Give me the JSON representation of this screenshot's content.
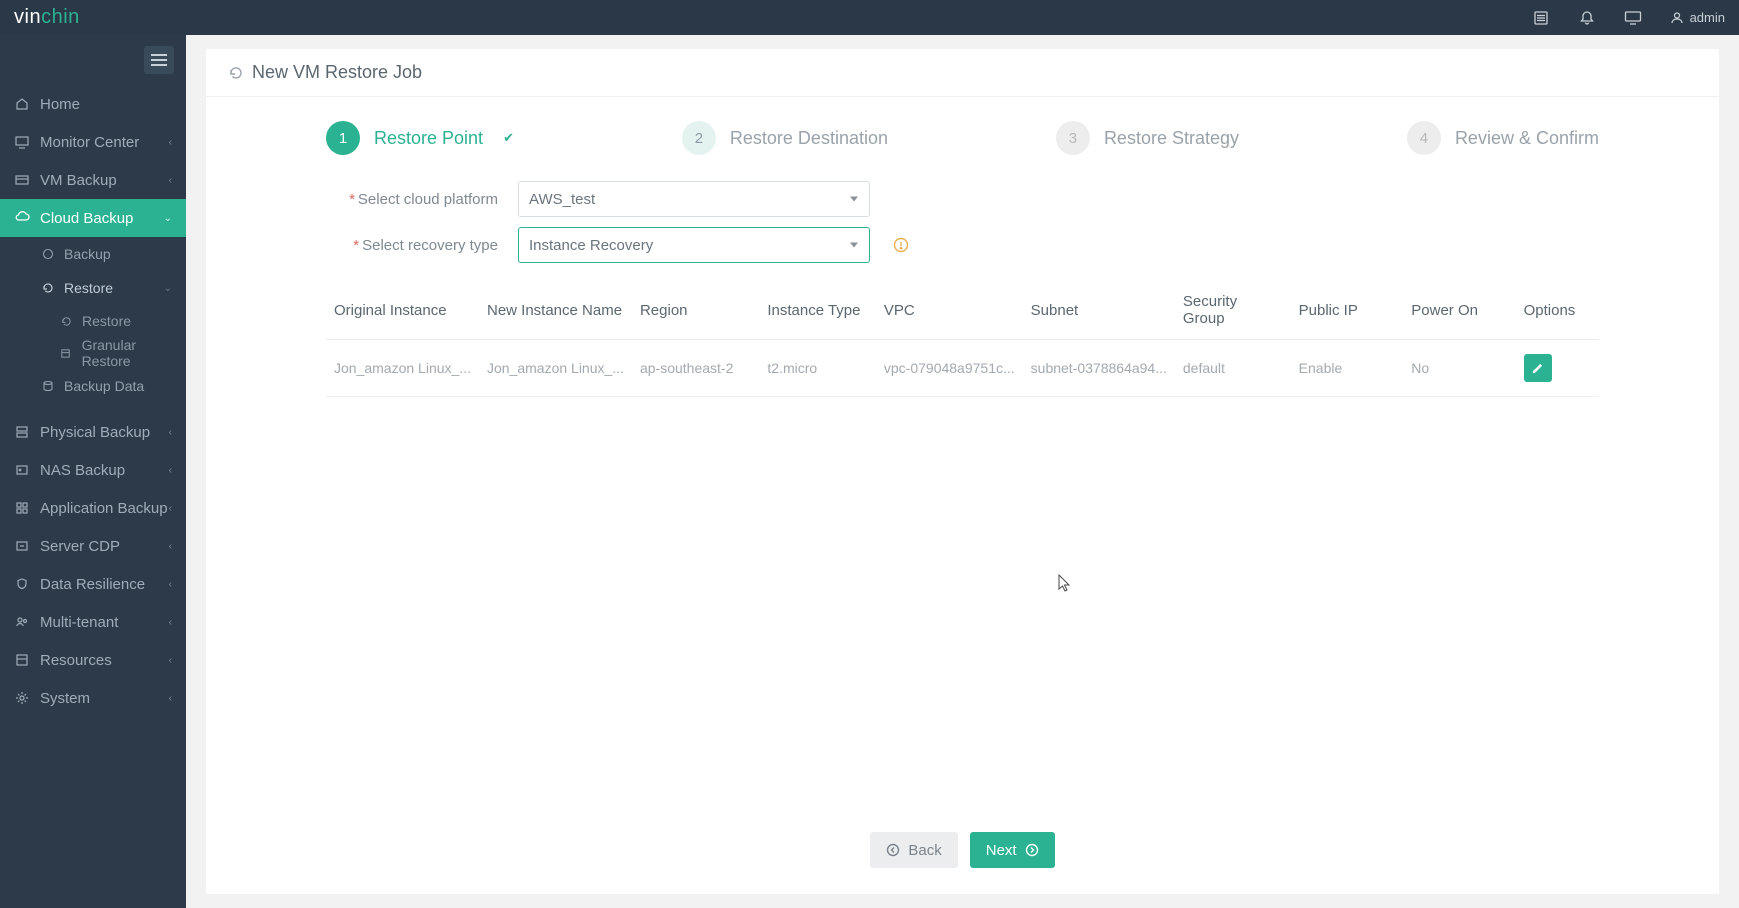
{
  "logo": {
    "pre": "vin",
    "post": "chin"
  },
  "topbar": {
    "user": "admin"
  },
  "sidebar": {
    "items": [
      {
        "label": "Home"
      },
      {
        "label": "Monitor Center"
      },
      {
        "label": "VM Backup"
      },
      {
        "label": "Cloud Backup"
      },
      {
        "label": "Physical Backup"
      },
      {
        "label": "NAS Backup"
      },
      {
        "label": "Application Backup"
      },
      {
        "label": "Server CDP"
      },
      {
        "label": "Data Resilience"
      },
      {
        "label": "Multi-tenant"
      },
      {
        "label": "Resources"
      },
      {
        "label": "System"
      }
    ],
    "cloud_sub": [
      {
        "label": "Backup"
      },
      {
        "label": "Restore"
      },
      {
        "label": "Backup Data"
      }
    ],
    "restore_sub": [
      {
        "label": "Restore"
      },
      {
        "label": "Granular Restore"
      }
    ]
  },
  "page": {
    "title": "New VM Restore Job"
  },
  "steps": [
    {
      "num": "1",
      "label": "Restore Point"
    },
    {
      "num": "2",
      "label": "Restore Destination"
    },
    {
      "num": "3",
      "label": "Restore Strategy"
    },
    {
      "num": "4",
      "label": "Review & Confirm"
    }
  ],
  "form": {
    "platform_label": "Select cloud platform",
    "platform_value": "AWS_test",
    "recovery_label": "Select recovery type",
    "recovery_value": "Instance Recovery"
  },
  "table": {
    "headers": {
      "original": "Original Instance",
      "newname": "New Instance Name",
      "region": "Region",
      "type": "Instance Type",
      "vpc": "VPC",
      "subnet": "Subnet",
      "sg": "Security Group",
      "publicip": "Public IP",
      "poweron": "Power On",
      "options": "Options"
    },
    "rows": [
      {
        "original": "Jon_amazon Linux_...",
        "newname": "Jon_amazon Linux_...",
        "region": "ap-southeast-2",
        "type": "t2.micro",
        "vpc": "vpc-079048a9751c...",
        "subnet": "subnet-0378864a94...",
        "sg": "default",
        "publicip": "Enable",
        "poweron": "No"
      }
    ]
  },
  "footer": {
    "back": "Back",
    "next": "Next"
  }
}
